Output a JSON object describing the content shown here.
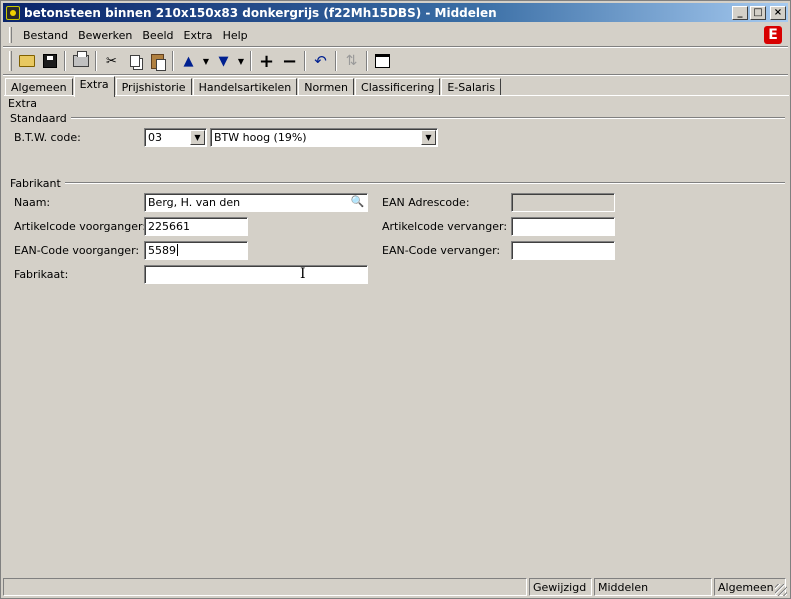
{
  "window": {
    "title": "betonsteen binnen 210x150x83 donkergrijs (f22Mh15DBS) - Middelen",
    "controls": {
      "minimize": "_",
      "maximize": "□",
      "close": "×"
    }
  },
  "menu": {
    "items": [
      {
        "label": "Bestand",
        "icon": ""
      },
      {
        "label": "Bewerken"
      },
      {
        "label": "Beeld"
      },
      {
        "label": "Extra"
      },
      {
        "label": "Help"
      }
    ],
    "brand_letter": "E"
  },
  "toolbar": {
    "icons": [
      "open-folder-icon",
      "save-icon",
      "print-icon",
      "cut-icon",
      "copy-icon",
      "paste-icon",
      "up-arrow-icon",
      "down-arrow-icon",
      "add-icon",
      "remove-icon",
      "undo-icon",
      "refresh-icon",
      "window-icon"
    ],
    "glyphs": {
      "cut": "✂",
      "up": "▲",
      "down": "▼",
      "dropdown": "▼",
      "add": "+",
      "remove": "−",
      "undo": "↶",
      "refresh": "⇅"
    }
  },
  "tabs": [
    {
      "label": "Algemeen",
      "active": false
    },
    {
      "label": "Extra",
      "active": true
    },
    {
      "label": "Prijshistorie",
      "active": false
    },
    {
      "label": "Handelsartikelen",
      "active": false
    },
    {
      "label": "Normen",
      "active": false
    },
    {
      "label": "Classificering",
      "active": false
    },
    {
      "label": "E-Salaris",
      "active": false
    }
  ],
  "panel": {
    "title": "Extra",
    "standaard": {
      "title": "Standaard",
      "btw_label": "B.T.W. code:",
      "btw_code": "03",
      "btw_description": "BTW hoog (19%)"
    },
    "fabrikant": {
      "title": "Fabrikant",
      "naam_label": "Naam:",
      "naam_value": "Berg, H. van den",
      "artikelcode_voorganger_label": "Artikelcode voorganger:",
      "artikelcode_voorganger_value": "225661",
      "ean_voorganger_label": "EAN-Code voorganger:",
      "ean_voorganger_value": "5589",
      "fabrikaat_label": "Fabrikaat:",
      "fabrikaat_value": "",
      "ean_adrescode_label": "EAN Adrescode:",
      "ean_adrescode_value": "",
      "artikelcode_vervanger_label": "Artikelcode vervanger:",
      "artikelcode_vervanger_value": "",
      "ean_vervanger_label": "EAN-Code vervanger:",
      "ean_vervanger_value": ""
    }
  },
  "statusbar": {
    "main": "",
    "state": "Gewijzigd",
    "module": "Middelen",
    "tab": "Algemeen"
  }
}
